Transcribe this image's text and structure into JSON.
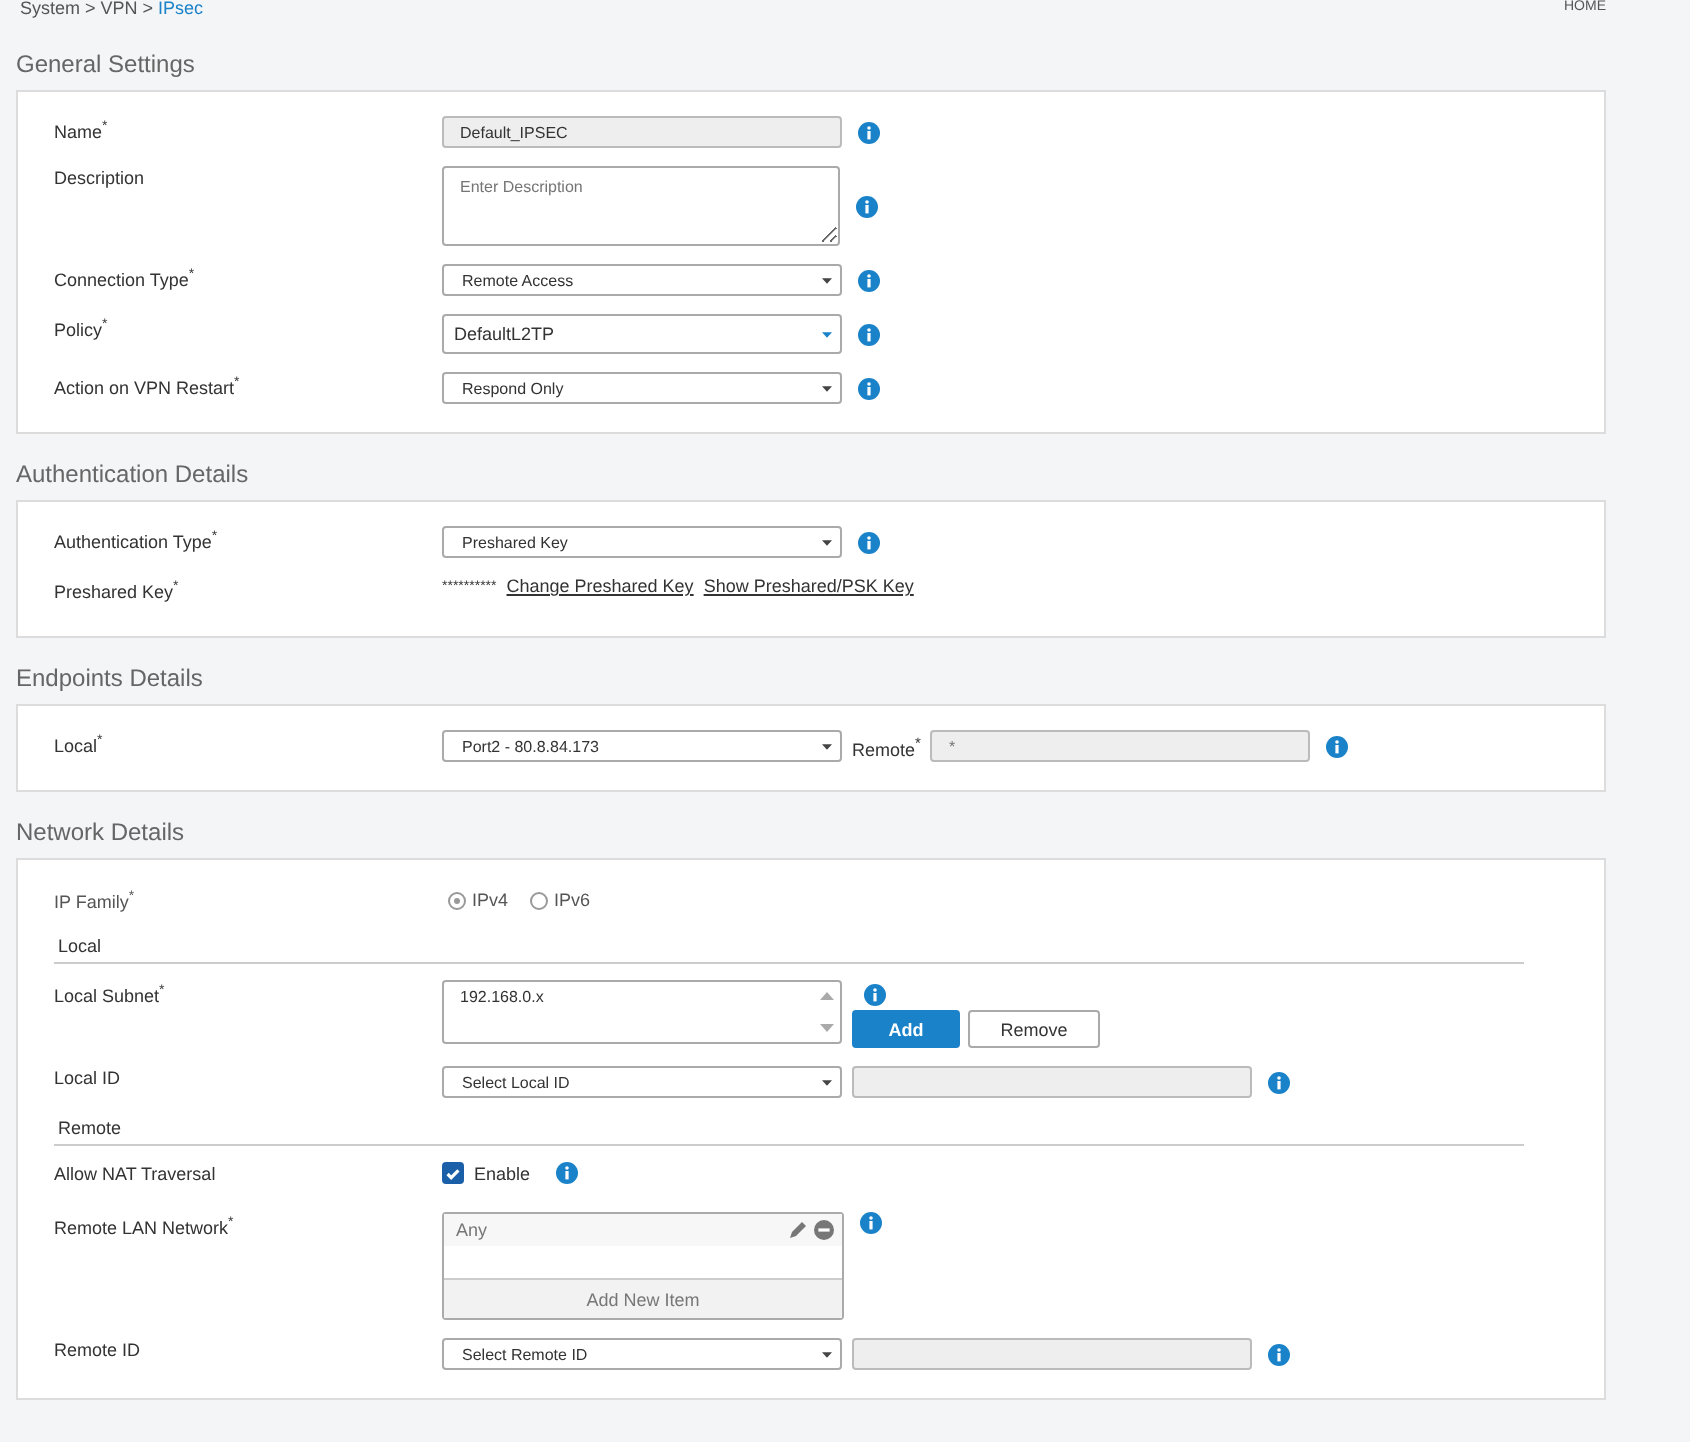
{
  "breadcrumb": {
    "path": "System > VPN > ",
    "current": "IPsec"
  },
  "home_link": "HOME",
  "sections": [
    {
      "title": "General Settings",
      "rows": [
        {
          "kind": "text",
          "label": "Name$^{*}$",
          "value": "Default_IPSEC",
          "info": true
        },
        {
          "kind": "textarea",
          "label": "Description",
          "placeholder": "Enter Description",
          "info": true
        },
        {
          "kind": "select",
          "label": "Connection Type$^{*}$",
          "value": "Remote Access",
          "large": false,
          "info": true
        },
        {
          "kind": "select",
          "label": "Policy$^{*}$",
          "value": "DefaultL2TP",
          "large": true,
          "info": true
        },
        {
          "kind": "select",
          "label": "Action on VPN Restart$^{*}$",
          "value": "Respond Only",
          "large": false,
          "info": true
        }
      ]
    },
    {
      "title": "Authentication Details",
      "rows": [
        {
          "kind": "select",
          "label": "Authentication Type$^{*}$",
          "value": "Preshared Key",
          "large": false,
          "info": true
        },
        {
          "kind": "links",
          "label": "Preshared Key$^{*}$",
          "masked": "**********",
          "links": [
            "Change Preshared Key",
            "Show Preshared/PSK Key"
          ]
        }
      ]
    },
    {
      "title": "Endpoints Details",
      "rows": [
        {
          "kind": "select_remote",
          "label": "Local$^{*}$",
          "value": "Port2 - 80.8.84.173",
          "remote_label": "Remote$^{*}$",
          "remote_placeholder": "*",
          "info": true
        }
      ]
    },
    {
      "title": "Network Details",
      "rows": [
        {
          "kind": "radio",
          "label": "IP Family$^{*}$",
          "options": [
            {
              "label": "IPv4",
              "selected": true
            },
            {
              "label": "IPv6",
              "selected": false
            }
          ]
        },
        {
          "kind": "subheading",
          "label": "Local"
        },
        {
          "kind": "listbox",
          "label": "Local Subnet$^{*}$",
          "items": [
            "192.168.0.x"
          ],
          "buttons": [
            {
              "label": "Add",
              "primary": true
            },
            {
              "label": "Remove",
              "primary": false
            }
          ],
          "info": true
        },
        {
          "kind": "select_field",
          "label": "Local ID",
          "value": "Select Local ID",
          "info": true
        },
        {
          "kind": "subheading",
          "label": "Remote"
        },
        {
          "kind": "checkbox",
          "label": "Allow NAT Traversal",
          "option": "Enable",
          "checked": true,
          "info": true
        },
        {
          "kind": "itemlist",
          "label": "Remote LAN Network$^{*}$",
          "items": [
            "Any"
          ],
          "add_label": "Add New Item",
          "info": true
        },
        {
          "kind": "select_field",
          "label": "Remote ID",
          "value": "Select Remote ID",
          "info": true
        }
      ]
    }
  ]
}
